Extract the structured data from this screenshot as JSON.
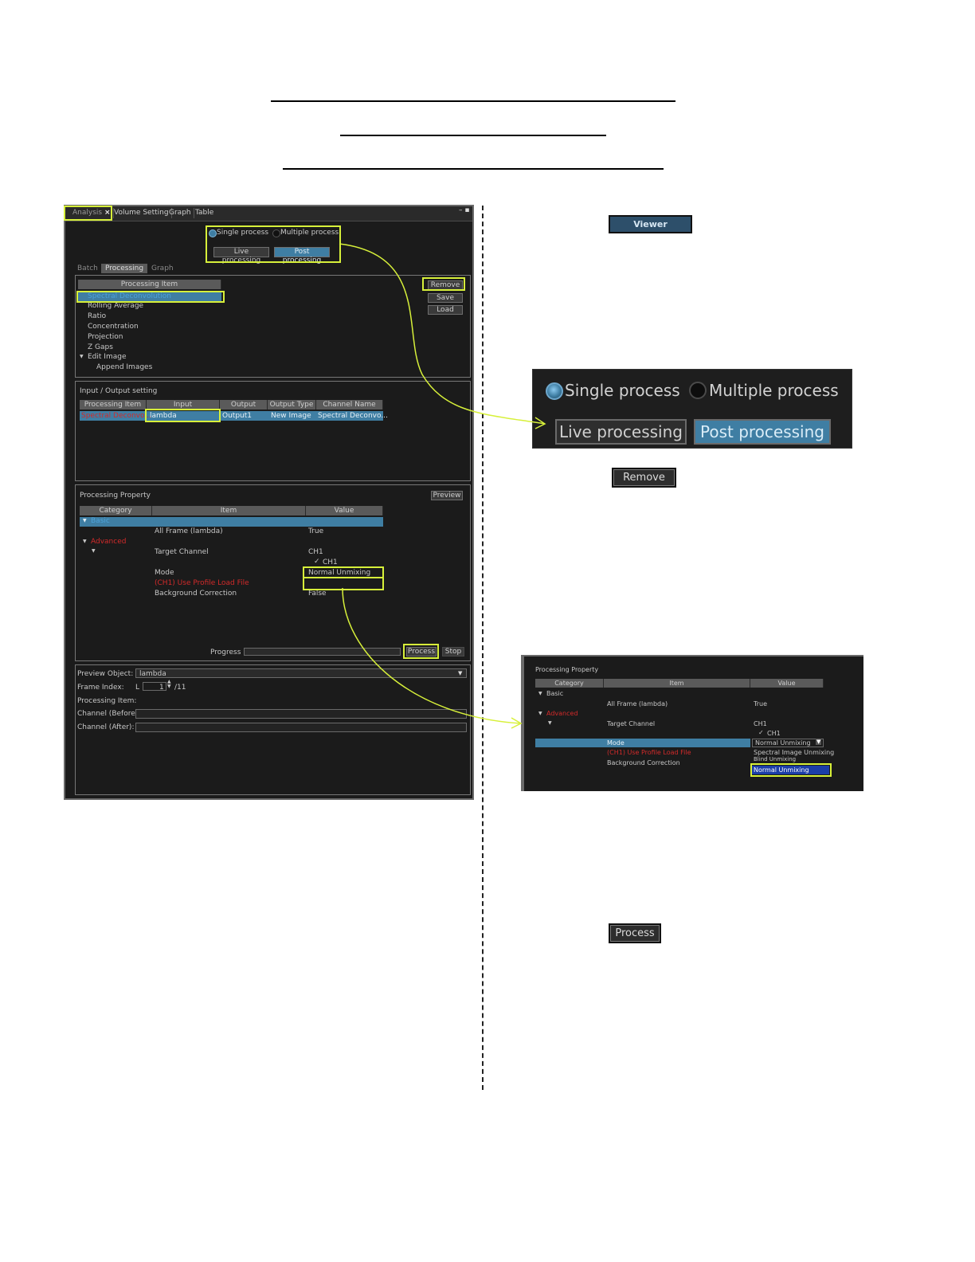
{
  "analysis_panel": {
    "tabs": [
      "Analysis",
      "Volume Setting",
      "Graph",
      "Table"
    ],
    "tab_close_glyph": "×",
    "window_controls": "– ▪",
    "process_mode": {
      "single": "Single process",
      "multiple": "Multiple process",
      "selected": "single"
    },
    "processing_mode": {
      "live": "Live processing",
      "post": "Post processing",
      "selected": "post"
    },
    "sub_tabs": [
      "Batch",
      "Processing",
      "Graph"
    ],
    "processing_item": {
      "header": "Processing Item",
      "items": [
        "Spectral Deconvolution",
        "Rolling Average",
        "Ratio",
        "Concentration",
        "Projection",
        "Z Gaps",
        "Edit Image",
        "Append Images"
      ],
      "expand_glyph": "▼",
      "buttons": {
        "remove": "Remove",
        "save": "Save",
        "load": "Load"
      }
    },
    "io_setting": {
      "title": "Input / Output setting",
      "columns": [
        "Processing Item",
        "Input",
        "Output",
        "Output Type",
        "Channel Name"
      ],
      "row": [
        "Spectral Deconvo...",
        "lambda",
        "Output1",
        "New Image",
        "Spectral Deconvo..."
      ]
    },
    "processing_property": {
      "title": "Processing Property",
      "preview_button": "Preview",
      "columns": [
        "Category",
        "Item",
        "Value"
      ],
      "category_basic": "Basic",
      "category_advanced": "Advanced",
      "rows": [
        {
          "item": "All Frame (lambda)",
          "value": "True"
        },
        {
          "item": "Target Channel",
          "value": "CH1"
        },
        {
          "item": "",
          "value": "CH1"
        },
        {
          "item": "Mode",
          "value": "Normal Unmixing"
        },
        {
          "item": "(CH1) Use Profile Load File",
          "value": ""
        },
        {
          "item": "Background Correction",
          "value": "False"
        }
      ],
      "check_glyph": "✓",
      "progress_label": "Progress :",
      "progress": 0,
      "process_button": "Process",
      "stop_button": "Stop"
    },
    "preview": {
      "object_label": "Preview Object:",
      "object_value": "lambda",
      "frame_label": "Frame Index:",
      "frame_prefix": "L",
      "frame_value": "1",
      "frame_total": "/11",
      "processing_item_label": "Processing Item:",
      "channel_before_label": "Channel (Before):",
      "channel_after_label": "Channel (After):"
    }
  },
  "viewer_button": "Viewer",
  "zoom_mode": {
    "single": "Single process",
    "multiple": "Multiple process",
    "live": "Live processing",
    "post": "Post processing"
  },
  "remove_button": "Remove",
  "zoom_property": {
    "title": "Processing Property",
    "columns": [
      "Category",
      "Item",
      "Value"
    ],
    "category_basic": "Basic",
    "category_advanced": "Advanced",
    "all_frame": "All Frame (lambda)",
    "all_frame_value": "True",
    "target_channel": "Target Channel",
    "target_value": "CH1",
    "ch1_sub": "CH1",
    "mode": "Mode",
    "mode_value": "Normal Unmixing",
    "use_profile": "(CH1) Use Profile Load File",
    "background": "Background Correction",
    "dropdown_options": [
      "Spectral Image Unmixing",
      "Blind Unmixing",
      "Normal Unmixing"
    ]
  },
  "process_button": "Process",
  "colors": {
    "highlight": "#d7f03a",
    "panel_bg": "#1b1b1b",
    "selection_blue": "#3f7ea3",
    "advanced_red": "#d32a2a"
  }
}
